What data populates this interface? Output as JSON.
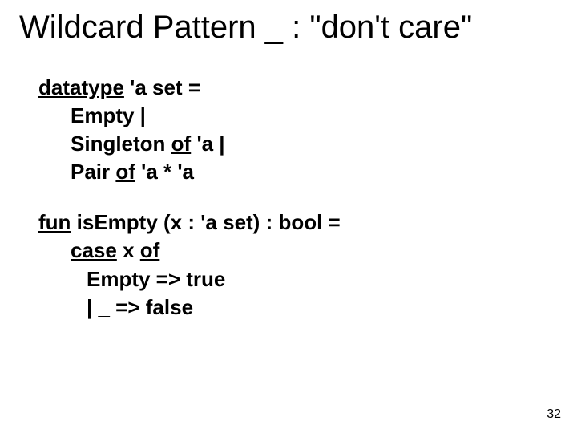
{
  "title": "Wildcard Pattern _ : \"don't care\"",
  "code": {
    "l1a": "datatype",
    "l1b": " 'a set =",
    "l2": "Empty |",
    "l3a": "Singleton ",
    "l3b": "of",
    "l3c": " 'a |",
    "l4a": "Pair ",
    "l4b": "of",
    "l4c": " 'a * 'a",
    "l5a": "fun",
    "l5b": " isEmpty (x : 'a set) : bool =",
    "l6a": "case",
    "l6b": " x ",
    "l6c": "of",
    "l7": "Empty => true",
    "l8": "| _ => false"
  },
  "pagenum": "32"
}
